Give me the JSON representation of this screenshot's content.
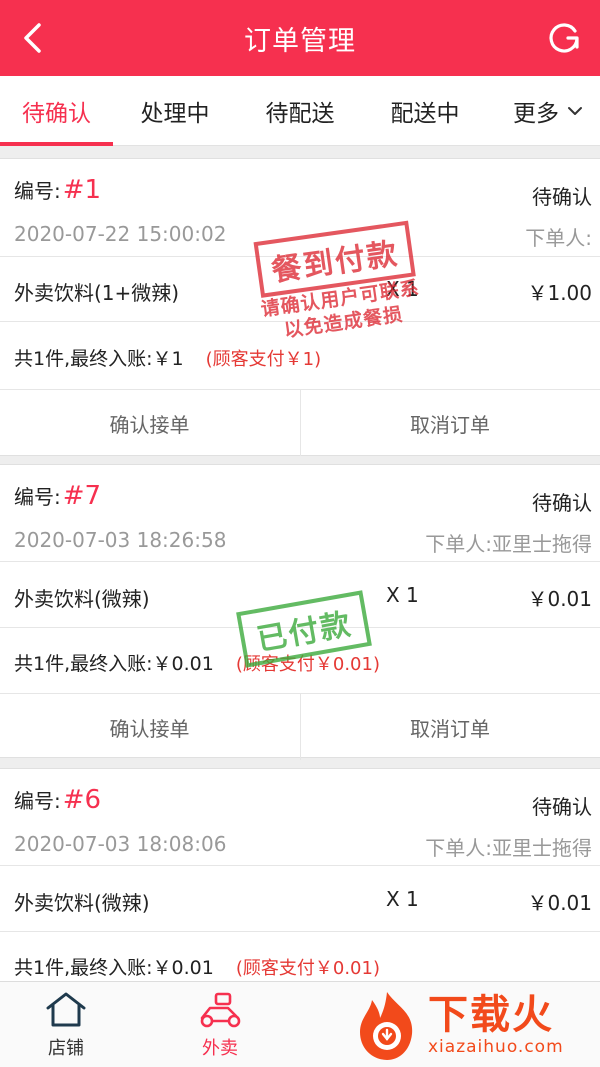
{
  "header": {
    "title": "订单管理"
  },
  "tabs": [
    {
      "label": "待确认",
      "active": true
    },
    {
      "label": "处理中",
      "active": false
    },
    {
      "label": "待配送",
      "active": false
    },
    {
      "label": "配送中",
      "active": false
    },
    {
      "label": "更多",
      "active": false
    }
  ],
  "orders": [
    {
      "number_label": "编号:",
      "number": "#1",
      "status": "待确认",
      "time": "2020-07-22 15:00:02",
      "customer": "下单人:",
      "item_name": "外卖饮料(1+微辣)",
      "item_qty": "X 1",
      "item_price": "￥1.00",
      "summary": "共1件,最终入账:￥1",
      "paid_note": "(顾客支付￥1)",
      "confirm_label": "确认接单",
      "cancel_label": "取消订单",
      "stamp_main": "餐到付款",
      "stamp_sub1": "请确认用户可联系",
      "stamp_sub2": "以免造成餐损"
    },
    {
      "number_label": "编号:",
      "number": "#7",
      "status": "待确认",
      "time": "2020-07-03 18:26:58",
      "customer": "下单人:亚里士拖得",
      "item_name": "外卖饮料(微辣)",
      "item_qty": "X 1",
      "item_price": "￥0.01",
      "summary": "共1件,最终入账:￥0.01",
      "paid_note": "(顾客支付￥0.01)",
      "confirm_label": "确认接单",
      "cancel_label": "取消订单",
      "stamp_main": "已付款"
    },
    {
      "number_label": "编号:",
      "number": "#6",
      "status": "待确认",
      "time": "2020-07-03 18:08:06",
      "customer": "下单人:亚里士拖得",
      "item_name": "外卖饮料(微辣)",
      "item_qty": "X 1",
      "item_price": "￥0.01",
      "summary": "共1件,最终入账:￥0.01",
      "paid_note": "(顾客支付￥0.01)"
    }
  ],
  "bottom_nav": [
    {
      "label": "店铺",
      "icon": "shop-icon",
      "active": false
    },
    {
      "label": "外卖",
      "icon": "scooter-icon",
      "active": true
    }
  ],
  "watermark": {
    "cn": "下载火",
    "en": "xiazaihuo.com"
  },
  "colors": {
    "primary": "#f6304f",
    "paid_note": "#e53935",
    "stamp_red": "#dc2832",
    "stamp_green": "#3caa3c",
    "watermark": "#f24a1b"
  }
}
